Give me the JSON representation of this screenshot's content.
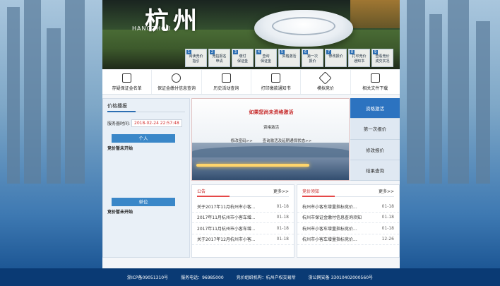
{
  "banner": {
    "logo_cn": "杭州",
    "logo_en": "HANGZHOU",
    "steps": [
      {
        "num": "1",
        "label": "阅读竞价\n指引"
      },
      {
        "num": "2",
        "label": "竞拍报名\n申请"
      },
      {
        "num": "3",
        "label": "缴付\n保证金"
      },
      {
        "num": "4",
        "label": "查询\n保证金"
      },
      {
        "num": "5",
        "label": "资格激活"
      },
      {
        "num": "6",
        "label": "第一次\n报价"
      },
      {
        "num": "7",
        "label": "修改报价"
      },
      {
        "num": "8",
        "label": "打印竞价\n通知书"
      },
      {
        "num": "9",
        "label": "查看竞价\n成交实况"
      }
    ]
  },
  "quickbar": {
    "items": [
      {
        "label": "存疑保证金名单",
        "icon": "document-icon"
      },
      {
        "label": "保证金缴付信息查询",
        "icon": "money-icon"
      },
      {
        "label": "历史活动查询",
        "icon": "calendar-icon"
      },
      {
        "label": "打印缴款通知书",
        "icon": "printer-icon"
      },
      {
        "label": "模拟竞价",
        "icon": "hammer-icon"
      },
      {
        "label": "相关文件下载",
        "icon": "book-icon"
      }
    ]
  },
  "leftcol": {
    "title": "价格播报",
    "server_label": "服务器时间:",
    "server_time": "2018-02-24 22:57:48",
    "personal_tag": "个人",
    "personal_status": "竞价暂未开始",
    "company_tag": "单位",
    "company_status": "竞价暂未开始"
  },
  "center": {
    "headline": "如果您尚未资格激活",
    "subtitle": "资格激活",
    "link_password": "修改密码>>",
    "link_query": "查询激活及延期通保状态>>"
  },
  "rmenu": {
    "items": [
      {
        "label": "资格激活",
        "active": true
      },
      {
        "label": "第一次报价",
        "active": false
      },
      {
        "label": "修改报价",
        "active": false
      },
      {
        "label": "结果查询",
        "active": false
      }
    ]
  },
  "notice": {
    "title": "公告",
    "more": "更多>>",
    "items": [
      {
        "title": "关于2017年11月杭州市小客...",
        "date": "01-18"
      },
      {
        "title": "2017年11月杭州市小客车增...",
        "date": "01-18"
      },
      {
        "title": "2017年11月杭州市小客车增...",
        "date": "01-18"
      },
      {
        "title": "关于2017年12月杭州市小客...",
        "date": "01-18"
      }
    ]
  },
  "price_notice": {
    "title": "竞价须知",
    "more": "更多>>",
    "items": [
      {
        "title": "杭州市小客车增量指标竞价...",
        "date": "01-18"
      },
      {
        "title": "杭州市保证金缴付信息查询须知",
        "date": "01-18"
      },
      {
        "title": "杭州市小客车增量指标竞价...",
        "date": "01-18"
      },
      {
        "title": "杭州市小客车增量指标竞价...",
        "date": "12-26"
      }
    ]
  },
  "footer": {
    "icp": "浙ICP备09051310号",
    "phone": "服务电话：96985000",
    "org": "竞价组织机构：杭州产权交易所",
    "police": "浙公网安备 33010402000560号"
  }
}
